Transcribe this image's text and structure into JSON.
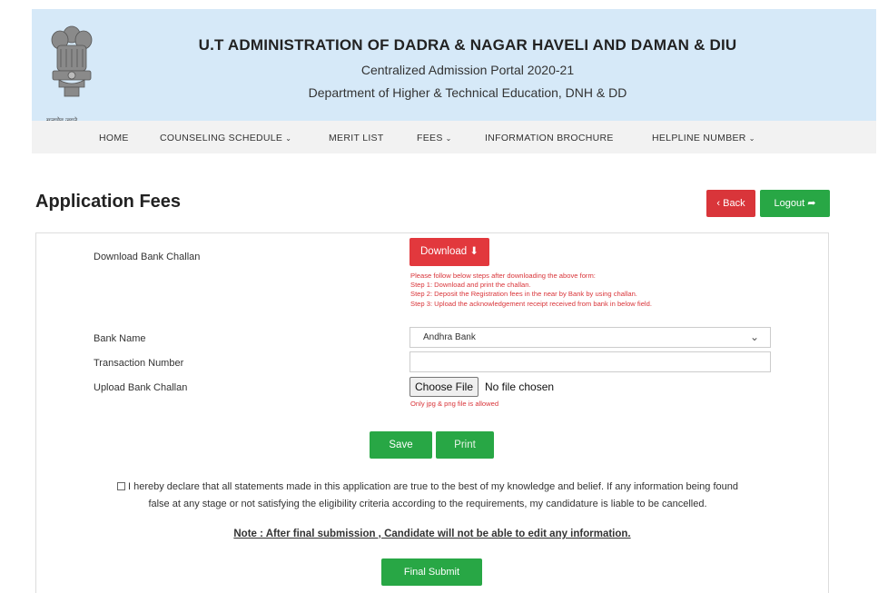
{
  "header": {
    "emblem_caption": "सत्यमेव जयते",
    "title": "U.T ADMINISTRATION OF DADRA & NAGAR HAVELI AND DAMAN & DIU",
    "subtitle1": "Centralized Admission Portal 2020-21",
    "subtitle2": "Department of Higher & Technical Education, DNH & DD"
  },
  "nav": {
    "items": [
      {
        "label": "HOME",
        "dropdown": false
      },
      {
        "label": "COUNSELING SCHEDULE",
        "dropdown": true
      },
      {
        "label": "MERIT LIST",
        "dropdown": false
      },
      {
        "label": "FEES",
        "dropdown": true
      },
      {
        "label": "INFORMATION BROCHURE",
        "dropdown": false
      },
      {
        "label": "HELPLINE NUMBER",
        "dropdown": true
      }
    ],
    "chevron": "⌄"
  },
  "page": {
    "title": "Application Fees",
    "back_label": "‹ Back",
    "logout_label": "Logout ➦"
  },
  "form": {
    "download_label": "Download Bank Challan",
    "download_button": "Download ⬇",
    "steps": [
      "Please follow below steps after downloading the above form:",
      "Step 1: Download and print the challan.",
      "Step 2: Deposit the Registration fees in the near by Bank by using challan.",
      "Step 3: Upload the acknowledgement receipt received from bank in below field."
    ],
    "bank_name_label": "Bank Name",
    "bank_name_value": "Andhra Bank",
    "transaction_label": "Transaction Number",
    "transaction_value": "",
    "upload_label": "Upload Bank Challan",
    "choose_file": "Choose File",
    "no_file": "No file chosen",
    "file_note": "Only jpg & png file is allowed",
    "save_label": "Save",
    "print_label": "Print"
  },
  "declaration": {
    "line1": "I hereby declare that all statements made in this application are true to the best of my knowledge and belief. If any information being found",
    "line2": "false at any stage or not satisfying the eligibility criteria according to the requirements, my candidature is liable to be cancelled.",
    "note": "Note : After final submission , Candidate will not be able to edit any information.",
    "final_submit": "Final Submit"
  },
  "colors": {
    "header_bg": "#d6e9f8",
    "nav_bg": "#f2f2f2",
    "red": "#d9353a",
    "green": "#28a745"
  }
}
